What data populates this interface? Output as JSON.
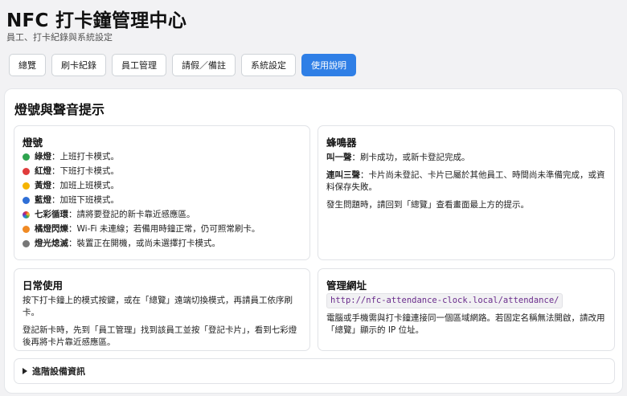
{
  "header": {
    "title": "NFC 打卡鐘管理中心",
    "subtitle": "員工、打卡紀錄與系統設定"
  },
  "tabs": [
    {
      "label": "總覽",
      "active": false
    },
    {
      "label": "刷卡紀錄",
      "active": false
    },
    {
      "label": "員工管理",
      "active": false
    },
    {
      "label": "請假／備註",
      "active": false
    },
    {
      "label": "系統設定",
      "active": false
    },
    {
      "label": "使用說明",
      "active": true
    }
  ],
  "colors": {
    "accent": "#2f7fe6"
  },
  "panel": {
    "title": "燈號與聲音提示",
    "lights": {
      "title": "燈號",
      "items": [
        {
          "color": "#2ea44f",
          "label": "綠燈",
          "desc": "：上班打卡模式。"
        },
        {
          "color": "#e03c3c",
          "label": "紅燈",
          "desc": "：下班打卡模式。"
        },
        {
          "color": "#f5b400",
          "label": "黃燈",
          "desc": "：加班上班模式。"
        },
        {
          "color": "#2f6fd6",
          "label": "藍燈",
          "desc": "：加班下班模式。"
        },
        {
          "color": "rainbow",
          "label": "七彩循環",
          "desc": "：請將要登記的新卡靠近感應區。"
        },
        {
          "color": "#f08a24",
          "label": "橘燈閃爍",
          "desc": "：Wi-Fi 未連線；若備用時鐘正常，仍可照常刷卡。"
        },
        {
          "color": "#777777",
          "label": "燈光熄滅",
          "desc": "：裝置正在開機，或尚未選擇打卡模式。"
        }
      ]
    },
    "buzzer": {
      "title": "蜂鳴器",
      "items": [
        {
          "label": "叫一聲",
          "desc": "：刷卡成功，或新卡登記完成。"
        },
        {
          "label": "連叫三聲",
          "desc": "：卡片尚未登記、卡片已屬於其他員工、時間尚未準備完成，或資料保存失敗。"
        }
      ],
      "note": "發生問題時，請回到「總覽」查看畫面最上方的提示。"
    },
    "daily": {
      "title": "日常使用",
      "paragraphs": [
        "按下打卡鐘上的模式按鍵，或在「總覽」遠端切換模式，再請員工依序刷卡。",
        "登記新卡時，先到「員工管理」找到該員工並按「登記卡片」，看到七彩燈後再將卡片靠近感應區。"
      ]
    },
    "admin": {
      "title": "管理網址",
      "url": "http://nfc-attendance-clock.local/attendance/",
      "note": "電腦或手機需與打卡鐘連接同一個區域網路。若固定名稱無法開啟，請改用「總覽」顯示的 IP 位址。"
    },
    "advanced": {
      "label": "進階設備資訊"
    }
  }
}
